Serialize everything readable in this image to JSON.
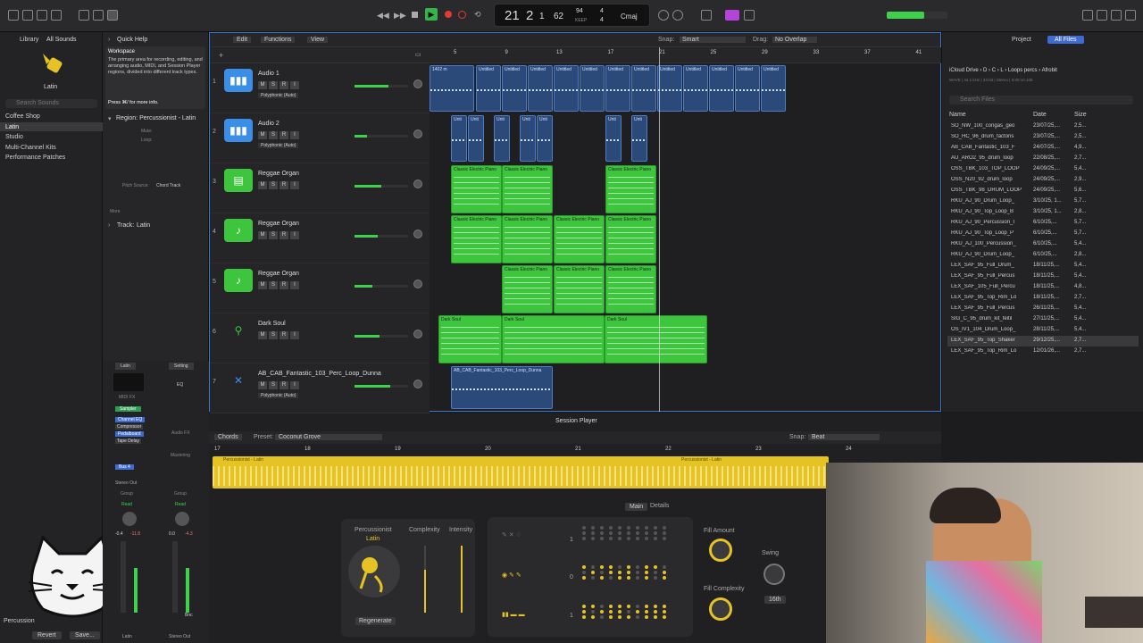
{
  "transport": {
    "bar": "21",
    "beat": "2",
    "div": "1",
    "tick": "62",
    "bpm": "94",
    "bpm_label": "KEEP",
    "sig_top": "4",
    "sig_bottom": "4",
    "key": "Cmaj",
    "tempo_sub": "4/4"
  },
  "library": {
    "title": "Library",
    "dropdown": "All Sounds",
    "patch_name": "Latin",
    "search_placeholder": "Search Sounds",
    "items": [
      "Coffee Shop",
      "Latin",
      "Studio",
      "Multi-Channel Kits",
      "Performance Patches"
    ],
    "bottom_label": "Percussion",
    "revert": "Revert",
    "save": "Save..."
  },
  "quickhelp": {
    "title": "Quick Help",
    "heading": "Workspace",
    "body": "The primary area for recording, editing, and arranging audio, MIDI, and Session Player regions, divided into different track types.",
    "shortcut": "Press ⌘/ for more info.",
    "region_label": "Region: Percussionist - Latin",
    "mute": "Mute:",
    "loop": "Loop:",
    "pitch_source": "Pitch Source:",
    "pitch_value": "Chord Track",
    "more": "More",
    "track_label": "Track:",
    "track_value": "Latin"
  },
  "menu": {
    "edit": "Edit",
    "functions": "Functions",
    "view": "View",
    "snap_label": "Snap:",
    "snap_value": "Smart",
    "drag_label": "Drag:",
    "drag_value": "No Overlap"
  },
  "ruler": [
    "5",
    "9",
    "13",
    "17",
    "21",
    "25",
    "29",
    "33",
    "37",
    "41"
  ],
  "tracks": [
    {
      "num": "1",
      "name": "Audio 1",
      "sub": "Polyphonic (Auto)",
      "type": "audio",
      "color": "#3a8ee6"
    },
    {
      "num": "2",
      "name": "Audio 2",
      "sub": "Polyphonic (Auto)",
      "type": "audio",
      "color": "#3a8ee6"
    },
    {
      "num": "3",
      "name": "Reggae Organ",
      "sub": "",
      "type": "organ",
      "color": "#3dc63d"
    },
    {
      "num": "4",
      "name": "Reggae Organ",
      "sub": "",
      "type": "note",
      "color": "#3dc63d"
    },
    {
      "num": "5",
      "name": "Reggae Organ",
      "sub": "",
      "type": "note",
      "color": "#3dc63d"
    },
    {
      "num": "6",
      "name": "Dark Soul",
      "sub": "",
      "type": "guitar",
      "color": "#3dc63d"
    },
    {
      "num": "7",
      "name": "AB_CAB_Fantastic_103_Perc_Loop_Dunna",
      "sub": "Polyphonic (Auto)",
      "type": "perc",
      "color": "#3a8ee6"
    }
  ],
  "regions": {
    "audio1_first": "1402 m",
    "untitled": "Untitled",
    "untitled3": "Untitled 3",
    "unti": "Unti",
    "untit": "Untit",
    "cep": "Classic Electric Piano",
    "dark": "Dark Soul",
    "perc": "AB_CAB_Fantastic_103_Perc_Loop_Dunna"
  },
  "filebrowser": {
    "tab_project": "Project",
    "tab_all": "All Files",
    "path": [
      "iCloud Drive",
      "D",
      "C",
      "L",
      "Loops percs",
      "Afrobit"
    ],
    "info": "WAVE | 44.1 kHz | 24-bit | Stereo | 0:00:10.108",
    "search_placeholder": "Search Files",
    "cols": [
      "Name",
      "Date",
      "Size"
    ],
    "files": [
      [
        "SO_NW_100_congas_geo",
        "23/07/25,...",
        "2,5..."
      ],
      [
        "SO_HC_96_drum_factoris",
        "23/07/25,...",
        "2,5..."
      ],
      [
        "AB_CAB_Fantastic_103_F",
        "24/07/25,...",
        "4,9..."
      ],
      [
        "AU_ARO2_95_drum_loop",
        "22/08/25,...",
        "2,7..."
      ],
      [
        "OSS_TBK_103_TOP_LOOP",
        "24/09/25,...",
        "5,4..."
      ],
      [
        "OSS_N20_92_drum_loop",
        "24/09/25,...",
        "2,9..."
      ],
      [
        "OSS_TBK_98_DRUM_LOOP",
        "24/09/25,...",
        "5,6..."
      ],
      [
        "RKU_AJ_90_Drum_Loop_",
        "3/10/25, 1...",
        "5,7..."
      ],
      [
        "RKU_AJ_90_Top_Loop_B",
        "3/10/25, 1...",
        "2,8..."
      ],
      [
        "RKU_AJ_90_Percussion_I",
        "6/10/25,...",
        "5,7..."
      ],
      [
        "RKU_AJ_90_Top_Loop_P",
        "6/10/25,...",
        "5,7..."
      ],
      [
        "RKU_AJ_100_Percussion_",
        "6/10/25,...",
        "5,4..."
      ],
      [
        "RKU_AJ_90_Drum_Loop_",
        "6/10/25,...",
        "2,8..."
      ],
      [
        "LEX_SAF_95_Full_Drum_",
        "18/11/25,...",
        "5,4..."
      ],
      [
        "LEX_SAF_95_Full_Percus",
        "18/11/25,...",
        "5,4..."
      ],
      [
        "LEX_SAF_105_Full_Percu",
        "18/11/25,...",
        "4,8..."
      ],
      [
        "LEX_SAF_95_Top_Rim_Lo",
        "18/11/25,...",
        "2,7..."
      ],
      [
        "LEX_SAF_95_Full_Percus",
        "26/11/25,...",
        "5,4..."
      ],
      [
        "SIG_C_95_drum_kit_feitil",
        "27/11/25,...",
        "5,4..."
      ],
      [
        "OS_IV1_104_Drum_Loop_",
        "28/11/25,...",
        "5,4..."
      ],
      [
        "LEX_SAF_95_Top_Shaker",
        "29/12/25,...",
        "2,7..."
      ],
      [
        "LEX_SAF_95_Top_Rim_Lo",
        "12/01/26,...",
        "2,7..."
      ]
    ]
  },
  "session": {
    "title": "Session Player",
    "chords": "Chords",
    "preset_label": "Preset:",
    "preset": "Coconut Grove",
    "snap_label": "Snap:",
    "snap": "Beat",
    "bars": [
      "17",
      "18",
      "19",
      "20",
      "21",
      "22",
      "23",
      "24"
    ],
    "region_label": "Percussionist - Latin",
    "tabs": [
      "Main",
      "Details"
    ],
    "percussionist": "Percussionist",
    "perc_value": "Latin",
    "complexity": "Complexity",
    "intensity": "Intensity",
    "regenerate": "Regenerate",
    "fill_amount": "Fill Amount",
    "fill_complexity": "Fill Complexity",
    "swing": "Swing",
    "swing_value": "16th",
    "row_nums": [
      "1",
      "0",
      "1"
    ]
  },
  "mixer": {
    "ch1": "Latin",
    "ch2": "Setting",
    "eq": "EQ",
    "midi_fx": "MIDI FX",
    "sampler": "Sampler",
    "inserts": [
      "Channel EQ",
      "Compressor",
      "Pedalboard",
      "Tape Delay"
    ],
    "audio_fx": "Audio FX",
    "mastering": "Mastering",
    "bus": "Bus 4",
    "stereo_out": "Stereo Out",
    "group": "Group",
    "read": "Read",
    "val1": "-0.4",
    "val2": "-11.8",
    "val3": "0.0",
    "val4": "-4.3",
    "name1": "Latin",
    "name2": "Stereo Out",
    "bnc": "Bnc"
  }
}
